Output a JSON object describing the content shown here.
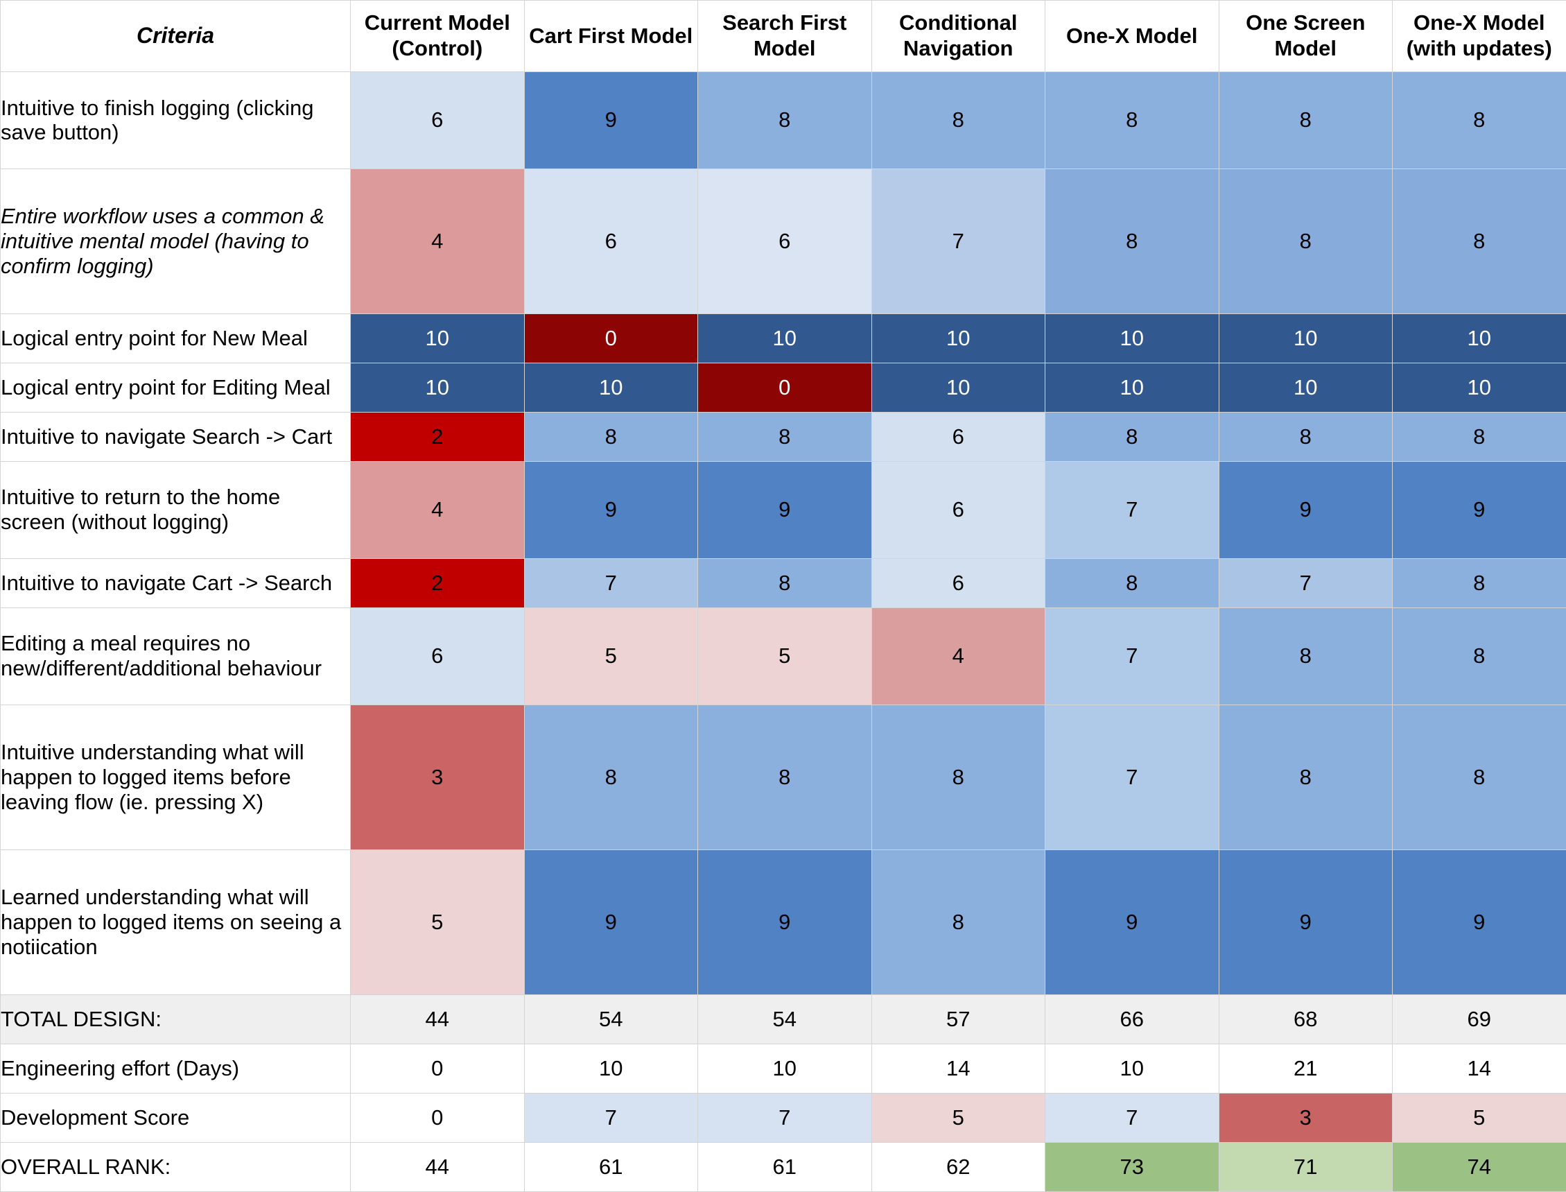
{
  "table": {
    "headers": [
      "Criteria",
      "Current Model (Control)",
      "Cart First Model",
      "Search First Model",
      "Conditional Navigation",
      "One-X Model",
      "One Screen Model",
      "One-X Model (with updates)"
    ],
    "rows": [
      {
        "criteria": "Intuitive to finish logging (clicking save button)",
        "italic": false,
        "values": [
          "6",
          "9",
          "8",
          "8",
          "8",
          "8",
          "8"
        ],
        "colors": [
          "#d3e0f0",
          "#5183c4",
          "#8cb0dd",
          "#8cb0dd",
          "#8cb0dd",
          "#8cb0dd",
          "#8cb0dd"
        ],
        "text_light": [
          false,
          false,
          false,
          false,
          false,
          false,
          false
        ]
      },
      {
        "criteria": "Entire workflow uses a common & intuitive mental model (having to confirm logging)",
        "italic": true,
        "values": [
          "4",
          "6",
          "6",
          "7",
          "8",
          "8",
          "8"
        ],
        "colors": [
          "#dc9a9a",
          "#d6e2f1",
          "#dae4f2",
          "#b5cbe8",
          "#87acdb",
          "#87acdb",
          "#87acdb"
        ],
        "text_light": [
          false,
          false,
          false,
          false,
          false,
          false,
          false
        ]
      },
      {
        "criteria": "Logical entry point for New Meal",
        "italic": false,
        "values": [
          "10",
          "0",
          "10",
          "10",
          "10",
          "10",
          "10"
        ],
        "colors": [
          "#31588f",
          "#8c0404",
          "#31588f",
          "#31588f",
          "#31588f",
          "#31588f",
          "#31588f"
        ],
        "text_light": [
          true,
          true,
          true,
          true,
          true,
          true,
          true
        ]
      },
      {
        "criteria": "Logical entry point for Editing Meal",
        "italic": false,
        "values": [
          "10",
          "10",
          "0",
          "10",
          "10",
          "10",
          "10"
        ],
        "colors": [
          "#31588f",
          "#31588f",
          "#8c0404",
          "#31588f",
          "#31588f",
          "#31588f",
          "#31588f"
        ],
        "text_light": [
          true,
          true,
          true,
          true,
          true,
          true,
          true
        ]
      },
      {
        "criteria": "Intuitive to navigate Search -> Cart",
        "italic": false,
        "values": [
          "2",
          "8",
          "8",
          "6",
          "8",
          "8",
          "8"
        ],
        "colors": [
          "#c00000",
          "#8cb0dd",
          "#8cb0dd",
          "#d3e0f0",
          "#8cb0dd",
          "#8cb0dd",
          "#8cb0dd"
        ],
        "text_light": [
          false,
          false,
          false,
          false,
          false,
          false,
          false
        ]
      },
      {
        "criteria": "Intuitive to return to the home screen (without logging)",
        "italic": false,
        "values": [
          "4",
          "9",
          "9",
          "6",
          "7",
          "9",
          "9"
        ],
        "colors": [
          "#dc9a9a",
          "#5183c4",
          "#5183c4",
          "#d3e0f0",
          "#afc9e9",
          "#5183c4",
          "#5183c4"
        ],
        "text_light": [
          false,
          false,
          false,
          false,
          false,
          false,
          false
        ]
      },
      {
        "criteria": "Intuitive to navigate Cart -> Search",
        "italic": false,
        "values": [
          "2",
          "7",
          "8",
          "6",
          "8",
          "7",
          "8"
        ],
        "colors": [
          "#c00000",
          "#a9c4e5",
          "#8cb0dd",
          "#d3e0f0",
          "#8cb0dd",
          "#a9c4e5",
          "#8cb0dd"
        ],
        "text_light": [
          false,
          false,
          false,
          false,
          false,
          false,
          false
        ]
      },
      {
        "criteria": "Editing a meal requires no new/different/additional behaviour",
        "italic": false,
        "values": [
          "6",
          "5",
          "5",
          "4",
          "7",
          "8",
          "8"
        ],
        "colors": [
          "#d3e0f0",
          "#edd3d3",
          "#edd3d3",
          "#db9e9e",
          "#afc9e9",
          "#8cb0dd",
          "#8cb0dd"
        ],
        "text_light": [
          false,
          false,
          false,
          false,
          false,
          false,
          false
        ]
      },
      {
        "criteria": "Intuitive understanding what will happen to logged items before leaving flow (ie. pressing X)",
        "italic": false,
        "values": [
          "3",
          "8",
          "8",
          "8",
          "7",
          "8",
          "8"
        ],
        "colors": [
          "#cb6565",
          "#8cb0dd",
          "#8cb0dd",
          "#8cb0dd",
          "#afc9e9",
          "#8cb0dd",
          "#8cb0dd"
        ],
        "text_light": [
          false,
          false,
          false,
          false,
          false,
          false,
          false
        ]
      },
      {
        "criteria": "Learned understanding what will happen to logged items on seeing a notiication",
        "italic": false,
        "values": [
          "5",
          "9",
          "9",
          "8",
          "9",
          "9",
          "9"
        ],
        "colors": [
          "#edd3d3",
          "#5183c4",
          "#5183c4",
          "#8cb0dd",
          "#5183c4",
          "#5183c4",
          "#5183c4"
        ],
        "text_light": [
          false,
          false,
          false,
          false,
          false,
          false,
          false
        ]
      },
      {
        "criteria": "TOTAL DESIGN:",
        "italic": false,
        "summary": true,
        "values": [
          "44",
          "54",
          "54",
          "57",
          "66",
          "68",
          "69"
        ],
        "colors": [
          "#efefef",
          "#efefef",
          "#efefef",
          "#efefef",
          "#efefef",
          "#efefef",
          "#efefef"
        ],
        "text_light": [
          false,
          false,
          false,
          false,
          false,
          false,
          false
        ]
      },
      {
        "criteria": "Engineering effort (Days)",
        "italic": false,
        "values": [
          "0",
          "10",
          "10",
          "14",
          "10",
          "21",
          "14"
        ],
        "colors": [
          "#ffffff",
          "#ffffff",
          "#ffffff",
          "#ffffff",
          "#ffffff",
          "#ffffff",
          "#ffffff"
        ],
        "text_light": [
          false,
          false,
          false,
          false,
          false,
          false,
          false
        ]
      },
      {
        "criteria": "Development Score",
        "italic": false,
        "values": [
          "0",
          "7",
          "7",
          "5",
          "7",
          "3",
          "5"
        ],
        "colors": [
          "#ffffff",
          "#d6e2f1",
          "#d6e2f1",
          "#eed5d5",
          "#d6e2f1",
          "#c96464",
          "#eed5d5"
        ],
        "text_light": [
          false,
          false,
          false,
          false,
          false,
          false,
          false
        ]
      },
      {
        "criteria": "OVERALL RANK:",
        "italic": false,
        "values": [
          "44",
          "61",
          "61",
          "62",
          "73",
          "71",
          "74"
        ],
        "colors": [
          "#ffffff",
          "#ffffff",
          "#ffffff",
          "#ffffff",
          "#9cc184",
          "#c3d9af",
          "#9cc184"
        ],
        "text_light": [
          false,
          false,
          false,
          false,
          false,
          false,
          false
        ]
      }
    ]
  }
}
